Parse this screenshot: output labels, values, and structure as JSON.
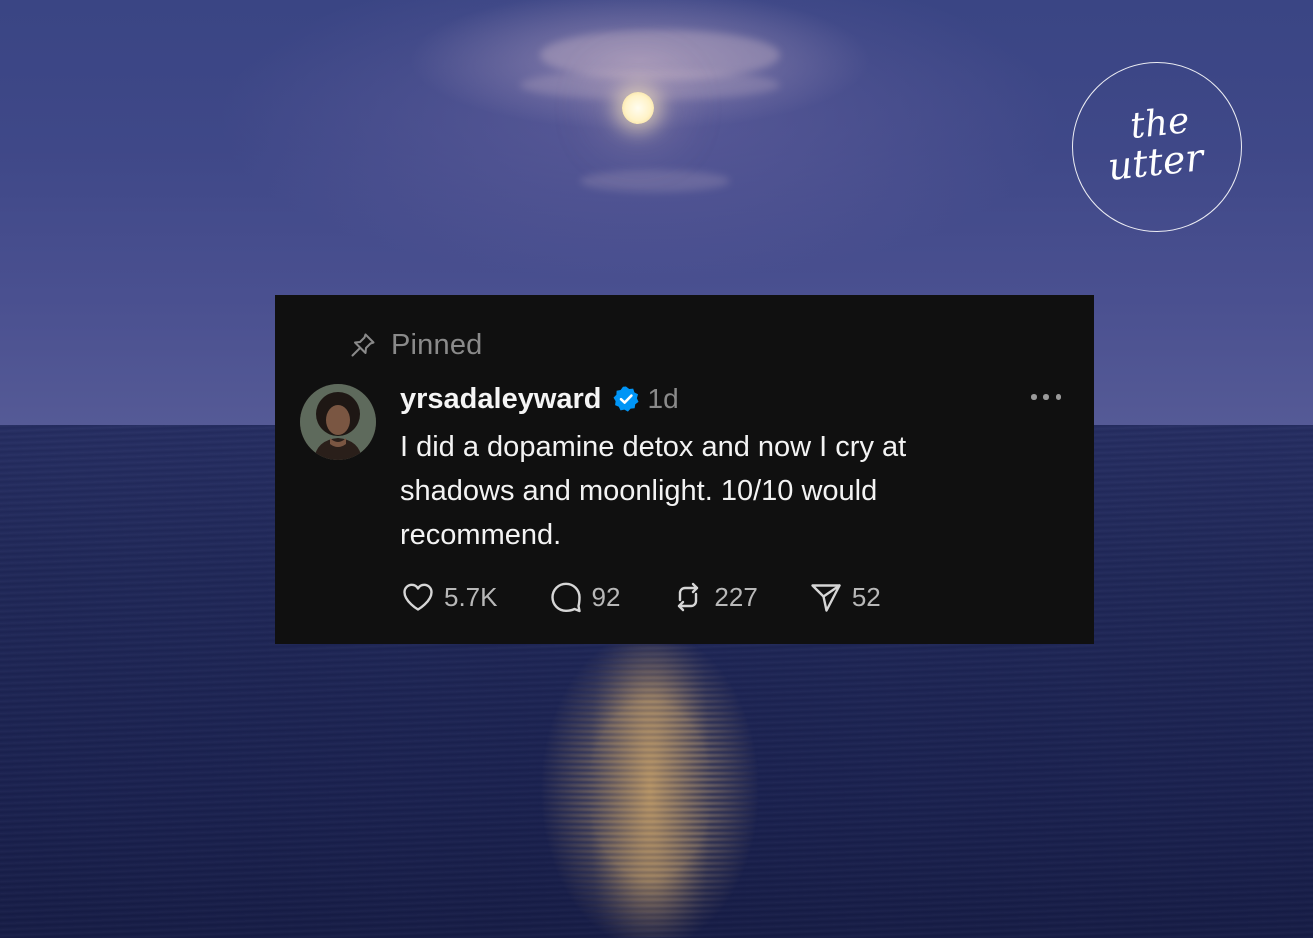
{
  "logo": {
    "text_line1": "the",
    "text_line2": "utter"
  },
  "post": {
    "pinned_label": "Pinned",
    "username": "yrsadaleyward",
    "verified": true,
    "time": "1d",
    "text": "I did a dopamine detox and now I cry at shadows and moonlight. 10/10 would recommend.",
    "actions": {
      "likes": "5.7K",
      "replies": "92",
      "reposts": "227",
      "shares": "52"
    }
  },
  "icons": [
    "pin-icon",
    "verified-badge-icon",
    "more-icon",
    "heart-icon",
    "comment-icon",
    "repost-icon",
    "send-icon"
  ],
  "colors": {
    "card_background": "#101010",
    "verified_blue": "#0095f6",
    "secondary_text": "#8a8a8a"
  }
}
